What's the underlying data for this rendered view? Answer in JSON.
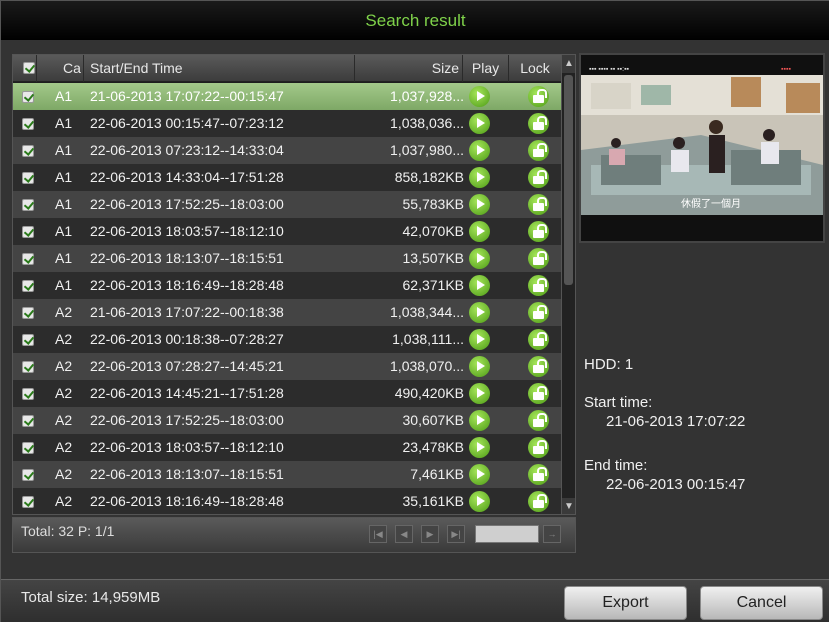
{
  "window": {
    "title": "Search result"
  },
  "table": {
    "headers": {
      "channel": "Ca",
      "time": "Start/End Time",
      "size": "Size",
      "play": "Play",
      "lock": "Lock"
    },
    "rows": [
      {
        "channel": "A1",
        "time": "21-06-2013 17:07:22--00:15:47",
        "size": "1,037,928...",
        "selected": true
      },
      {
        "channel": "A1",
        "time": "22-06-2013 00:15:47--07:23:12",
        "size": "1,038,036..."
      },
      {
        "channel": "A1",
        "time": "22-06-2013 07:23:12--14:33:04",
        "size": "1,037,980..."
      },
      {
        "channel": "A1",
        "time": "22-06-2013 14:33:04--17:51:28",
        "size": "858,182KB"
      },
      {
        "channel": "A1",
        "time": "22-06-2013 17:52:25--18:03:00",
        "size": "55,783KB"
      },
      {
        "channel": "A1",
        "time": "22-06-2013 18:03:57--18:12:10",
        "size": "42,070KB"
      },
      {
        "channel": "A1",
        "time": "22-06-2013 18:13:07--18:15:51",
        "size": "13,507KB"
      },
      {
        "channel": "A1",
        "time": "22-06-2013 18:16:49--18:28:48",
        "size": "62,371KB"
      },
      {
        "channel": "A2",
        "time": "21-06-2013 17:07:22--00:18:38",
        "size": "1,038,344..."
      },
      {
        "channel": "A2",
        "time": "22-06-2013 00:18:38--07:28:27",
        "size": "1,038,111..."
      },
      {
        "channel": "A2",
        "time": "22-06-2013 07:28:27--14:45:21",
        "size": "1,038,070..."
      },
      {
        "channel": "A2",
        "time": "22-06-2013 14:45:21--17:51:28",
        "size": "490,420KB"
      },
      {
        "channel": "A2",
        "time": "22-06-2013 17:52:25--18:03:00",
        "size": "30,607KB"
      },
      {
        "channel": "A2",
        "time": "22-06-2013 18:03:57--18:12:10",
        "size": "23,478KB"
      },
      {
        "channel": "A2",
        "time": "22-06-2013 18:13:07--18:15:51",
        "size": "7,461KB"
      },
      {
        "channel": "A2",
        "time": "22-06-2013 18:16:49--18:28:48",
        "size": "35,161KB",
        "partial": true
      }
    ],
    "footer": {
      "total": "Total: 32  P: 1/1"
    }
  },
  "preview": {
    "caption": "休假了一個月"
  },
  "info": {
    "hdd": "HDD: 1",
    "start_label": "Start time:",
    "start_value": "21-06-2013 17:07:22",
    "end_label": "End time:",
    "end_value": "22-06-2013 00:15:47"
  },
  "bottom": {
    "total_size": "Total size: 14,959MB",
    "export_label": "Export",
    "cancel_label": "Cancel"
  },
  "colors": {
    "title": "#7fd24a",
    "selected_row": "#8fb877",
    "button_green": "#5fb020"
  }
}
